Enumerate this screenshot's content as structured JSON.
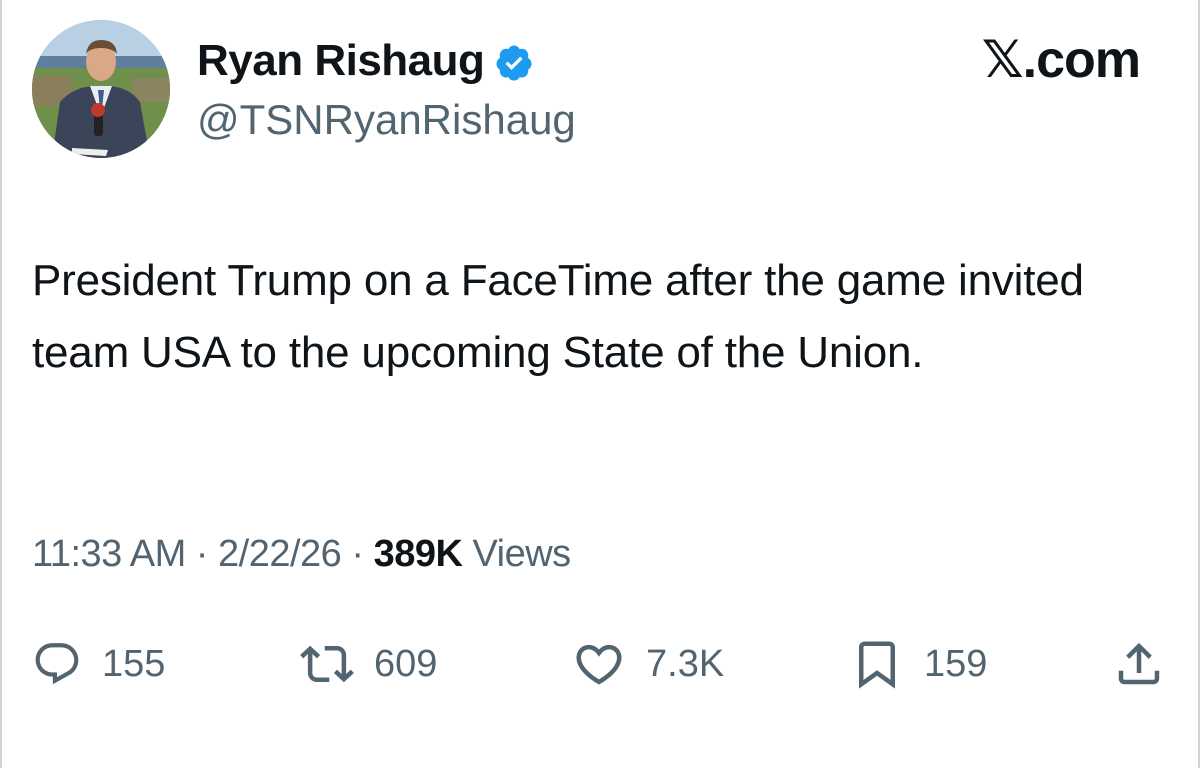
{
  "author": {
    "display_name": "Ryan Rishaug",
    "handle": "@TSNRyanRishaug",
    "verified": true,
    "verified_color": "#1d9bf0"
  },
  "brand": "𝕏.com",
  "tweet": {
    "text": "President Trump on a FaceTime after the game invited team USA to the upcoming State of the Union."
  },
  "meta": {
    "time": "11:33 AM",
    "separator": "·",
    "date": "2/22/26",
    "views_count": "389K",
    "views_label": "Views"
  },
  "actions": {
    "reply": {
      "icon": "reply-icon",
      "count": "155"
    },
    "retweet": {
      "icon": "retweet-icon",
      "count": "609"
    },
    "like": {
      "icon": "heart-icon",
      "count": "7.3K"
    },
    "bookmark": {
      "icon": "bookmark-icon",
      "count": "159"
    },
    "share": {
      "icon": "share-icon"
    }
  },
  "colors": {
    "text_primary": "#0f1419",
    "text_secondary": "#536471",
    "background": "#ffffff"
  }
}
